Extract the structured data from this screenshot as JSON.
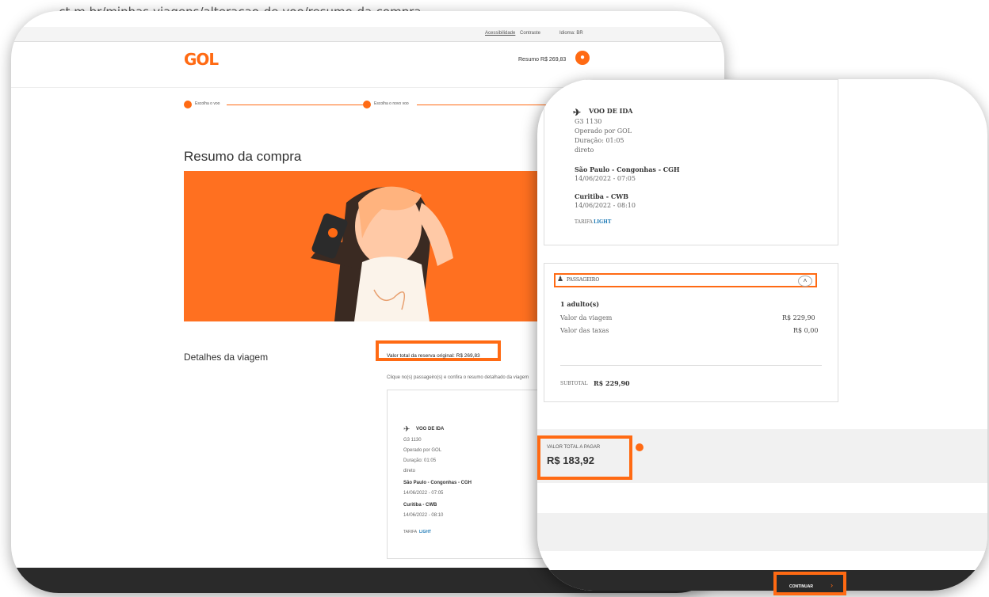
{
  "browser": {
    "url": "...ct.m.br/minhas-viagens/alteracao-de-voo/resumo-da-compra"
  },
  "topbar": {
    "acessibilidade": "Acessibilidade",
    "contraste": "Contraste",
    "idioma": "Idioma: BR"
  },
  "header": {
    "logo": "GOL",
    "resumo_label": "Resumo R$ 269,83",
    "cart_icon": "cart-icon"
  },
  "steps": [
    "Escolha o voo",
    "Escolha o novo voo"
  ],
  "page": {
    "title": "Resumo da compra"
  },
  "details": {
    "title": "Detalhes da viagem",
    "original_total": "Valor total da reserva original: R$ 269,83",
    "hint": "Clique no(s) passageiro(s) e confira o resumo detalhado da viagem"
  },
  "flight": {
    "heading": "VOO DE IDA",
    "number": "G3 1130",
    "operator": "Operado por GOL",
    "duration": "Duração: 01:05",
    "type": "direto",
    "origin": "São Paulo - Congonhas - CGH",
    "origin_time": "14/06/2022 - 07:05",
    "destination": "Curitiba - CWB",
    "destination_time": "14/06/2022 - 08:10",
    "fare_prefix": "TARIFA",
    "fare_name": "LIGHT"
  },
  "passenger": {
    "heading": "PASSAGEIRO",
    "count": "1 adulto(s)",
    "trip_label": "Valor da viagem",
    "trip_value": "R$ 229,90",
    "taxes_label": "Valor das taxas",
    "taxes_value": "R$ 0,00",
    "subtotal_label": "SUBTOTAL",
    "subtotal_value": "R$ 229,90"
  },
  "total": {
    "label": "VALOR TOTAL A PAGAR",
    "value": "R$ 183,92"
  },
  "footer": {
    "continue_label": "CONTINUAR"
  },
  "colors": {
    "accent": "#ff6a13",
    "link": "#1e7ab6",
    "dark": "#2a2a2a"
  }
}
